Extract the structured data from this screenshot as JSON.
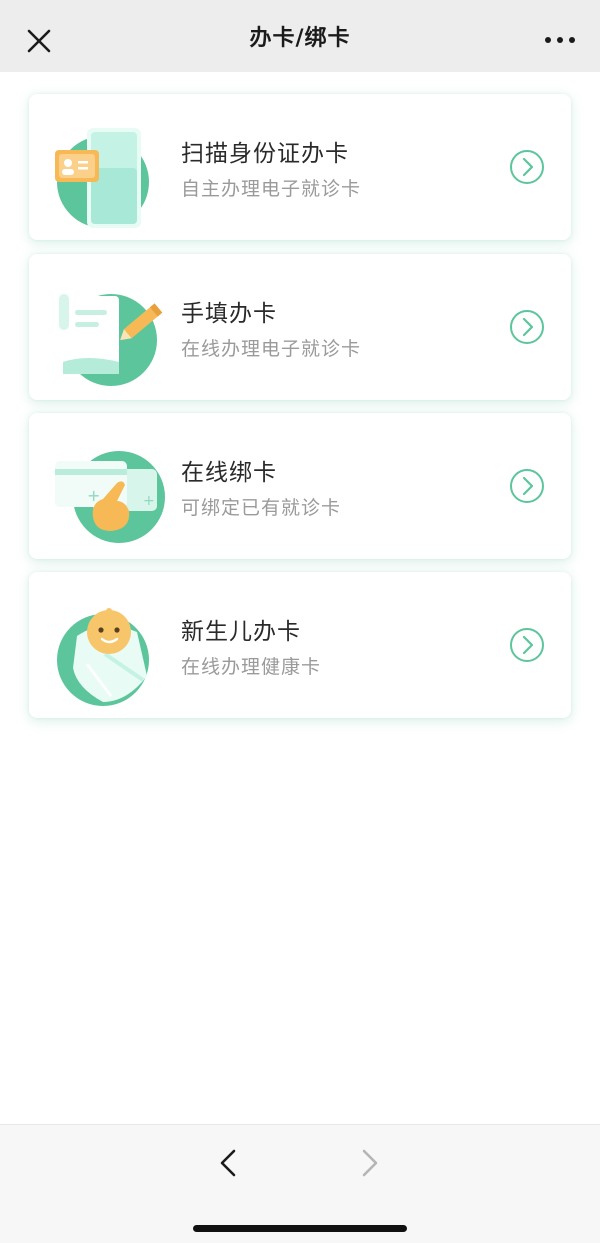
{
  "header": {
    "title": "办卡/绑卡"
  },
  "cards": [
    {
      "title": "扫描身份证办卡",
      "subtitle": "自主办理电子就诊卡"
    },
    {
      "title": "手填办卡",
      "subtitle": "在线办理电子就诊卡"
    },
    {
      "title": "在线绑卡",
      "subtitle": "可绑定已有就诊卡"
    },
    {
      "title": "新生儿办卡",
      "subtitle": "在线办理健康卡"
    }
  ],
  "colors": {
    "accent": "#5cc59c",
    "header_bg": "#ededed",
    "title_text": "#2a2a2a",
    "subtitle_text": "#9a9a9a"
  },
  "icons": {
    "close": "close-icon",
    "more": "more-icon",
    "chevron": "chevron-right-circle-icon",
    "back": "back-arrow-icon",
    "forward": "forward-arrow-icon"
  }
}
